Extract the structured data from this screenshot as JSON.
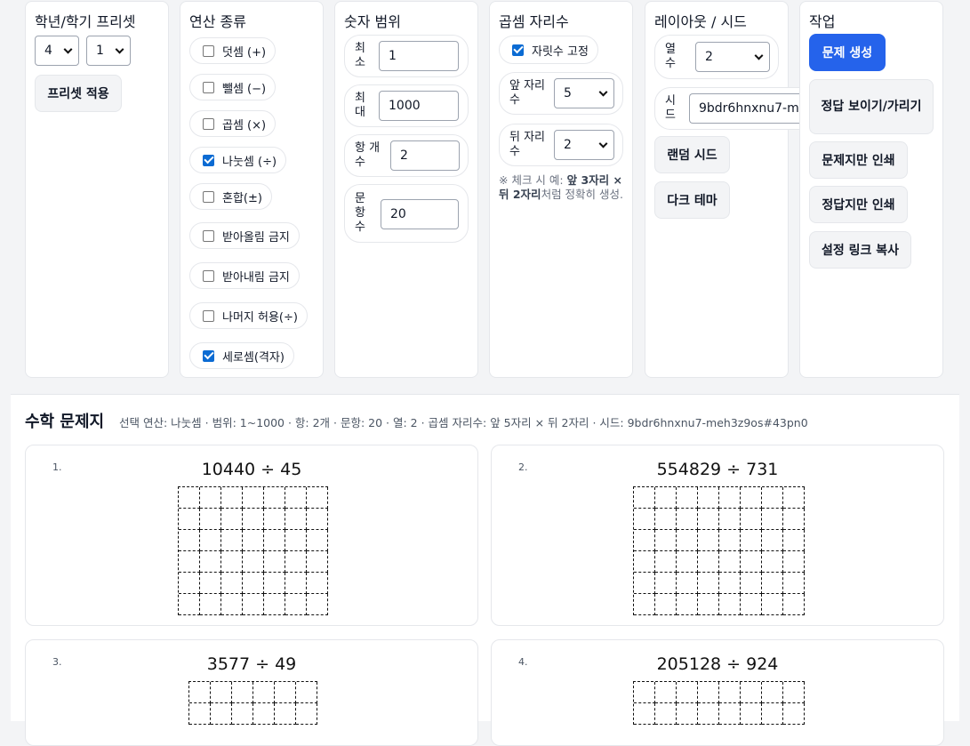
{
  "preset": {
    "title": "학년/학기 프리셋",
    "grade": "4",
    "semester": "1",
    "apply_label": "프리셋 적용"
  },
  "operations": {
    "title": "연산 종류",
    "items": [
      {
        "label": "덧셈 (+)",
        "checked": false
      },
      {
        "label": "뺄셈 (−)",
        "checked": false
      },
      {
        "label": "곱셈 (×)",
        "checked": false
      },
      {
        "label": "나눗셈 (÷)",
        "checked": true
      },
      {
        "label": "혼합(±)",
        "checked": false
      },
      {
        "label": "받아올림 금지",
        "checked": false
      },
      {
        "label": "받아내림 금지",
        "checked": false
      },
      {
        "label": "나머지 허용(÷)",
        "checked": false
      },
      {
        "label": "세로셈(격자)",
        "checked": true
      }
    ]
  },
  "range": {
    "title": "숫자 범위",
    "min_label": "최\n소",
    "min_value": "1",
    "max_label": "최\n대",
    "max_value": "1000",
    "terms_label": "항 개\n수",
    "terms_value": "2",
    "count_label": "문\n항\n수",
    "count_value": "20"
  },
  "digits": {
    "title": "곱셈 자리수",
    "fix_label": "자릿수 고정",
    "fix_checked": true,
    "front_label": "앞 자리\n수",
    "front_value": "5",
    "back_label": "뒤 자리\n수",
    "back_value": "2",
    "note_prefix": "※ 체크 시 예: ",
    "note_b1": "앞 3자리",
    "note_mid": " × ",
    "note_b2": "뒤 2자리",
    "note_suffix": "처럼 정확히 생성."
  },
  "layout": {
    "title": "레이아웃 / 시드",
    "columns_label": "열\n수",
    "columns_value": "2",
    "seed_label": "시\n드",
    "seed_value": "9bdr6hnxnu7-meh3z9os#43pn0",
    "random_seed_label": "랜덤 시드",
    "dark_theme_label": "다크 테마"
  },
  "actions": {
    "title": "작업",
    "generate_label": "문제 생성",
    "toggle_answers_label": "정답 보이기/가리기",
    "print_problems_label": "문제지만 인쇄",
    "print_answers_label": "정답지만 인쇄",
    "copy_link_label": "설정 링크 복사"
  },
  "sheet": {
    "title": "수학 문제지",
    "meta": "선택 연산: 나눗셈 · 범위: 1~1000 · 항: 2개 · 문항: 20 · 열: 2 · 곱셈 자리수: 앞 5자리 × 뒤 2자리 · 시드: 9bdr6hnxnu7-meh3z9os#43pn0",
    "problems": [
      {
        "num": "1.",
        "expr": "10440 ÷ 45",
        "cols": 7,
        "rows": 6
      },
      {
        "num": "2.",
        "expr": "554829 ÷ 731",
        "cols": 8,
        "rows": 6
      },
      {
        "num": "3.",
        "expr": "3577 ÷ 49",
        "cols": 6,
        "rows": 2
      },
      {
        "num": "4.",
        "expr": "205128 ÷ 924",
        "cols": 8,
        "rows": 2
      }
    ]
  },
  "colors": {
    "primary": "#2563eb",
    "checkbox": "#0b6bd3"
  }
}
